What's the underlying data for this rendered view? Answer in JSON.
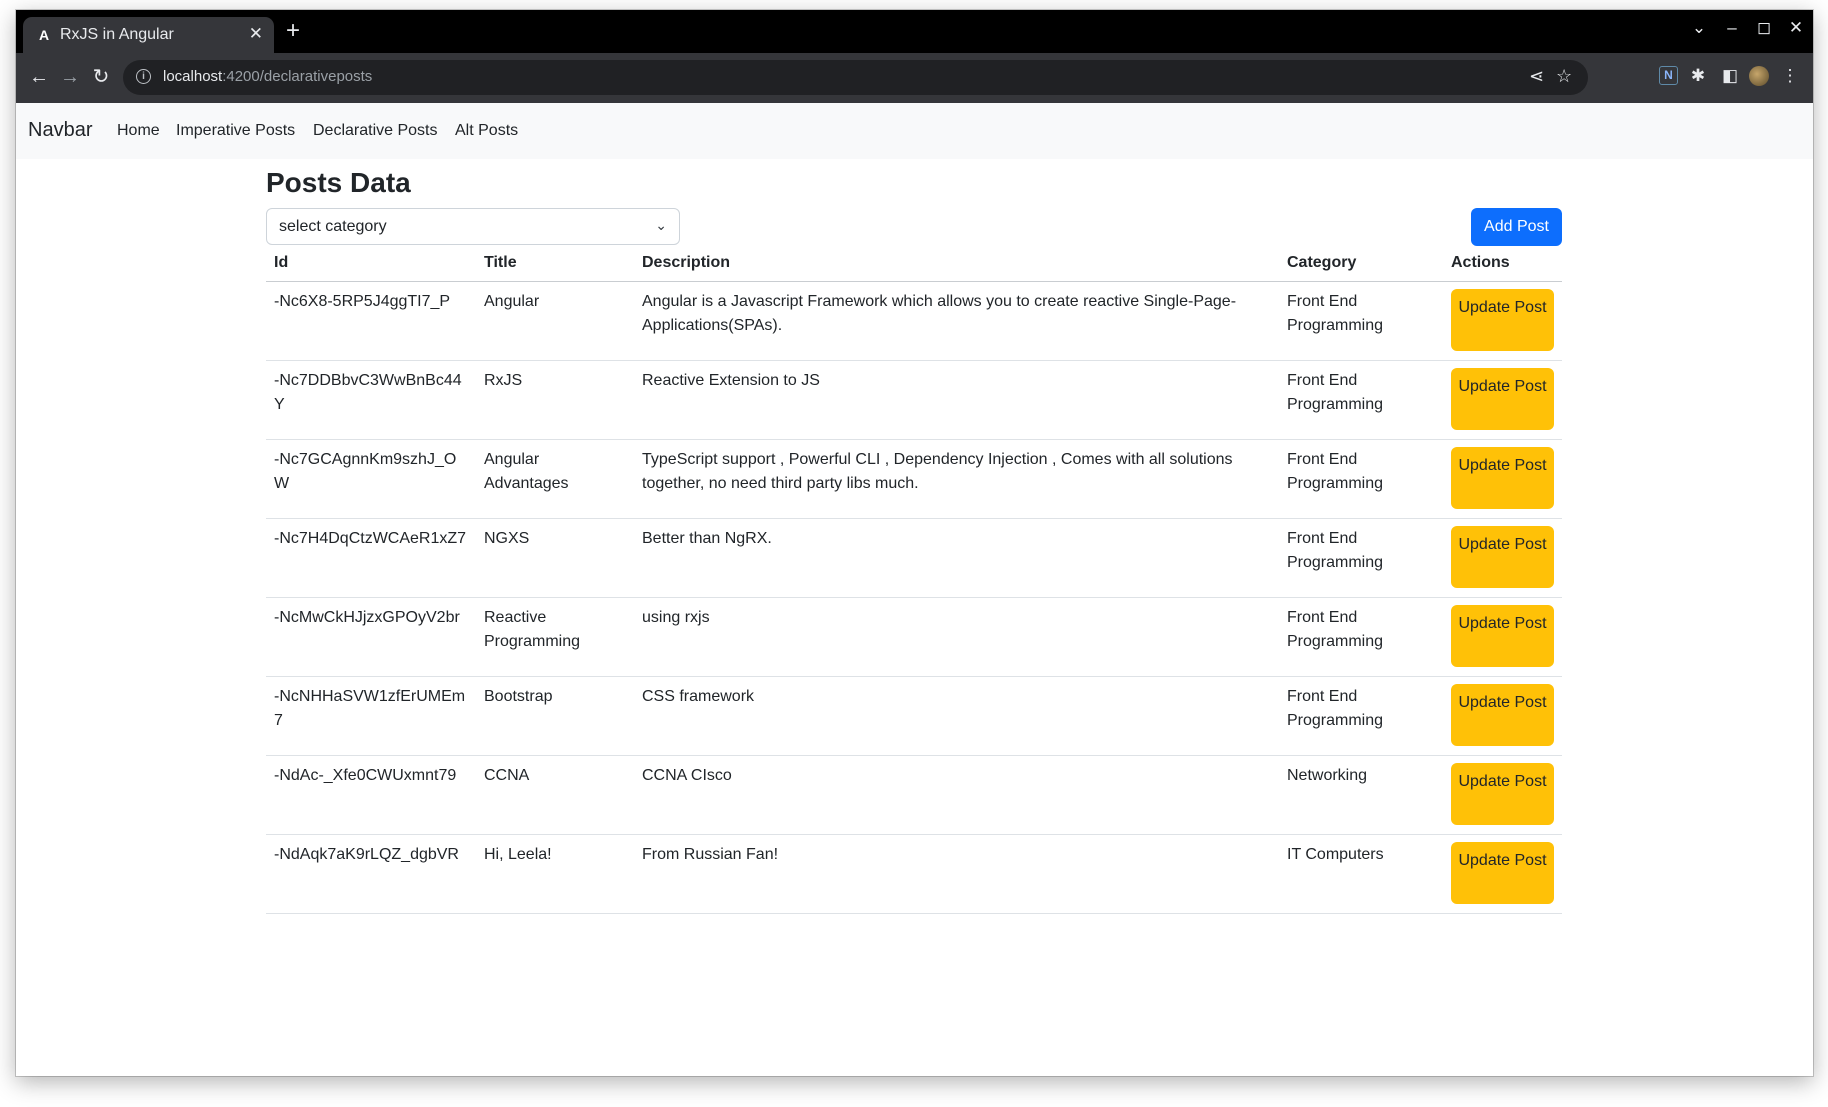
{
  "browser": {
    "tab_title": "RxJS in Angular",
    "tab_favicon": "A",
    "url_host": "localhost",
    "url_path": ":4200/declarativeposts"
  },
  "navbar": {
    "brand": "Navbar",
    "links": [
      "Home",
      "Imperative Posts",
      "Declarative Posts",
      "Alt Posts"
    ]
  },
  "main": {
    "heading": "Posts Data",
    "category_select": {
      "value": "select category"
    },
    "add_button": "Add Post",
    "table": {
      "columns": [
        "Id",
        "Title",
        "Description",
        "Category",
        "Actions"
      ],
      "rows": [
        {
          "id": "-Nc6X8-5RP5J4ggTI7_P",
          "title": "Angular",
          "description": "Angular is a Javascript Framework which allows you to create reactive Single-Page-Applications(SPAs).",
          "category": "Front End Programming",
          "action": "Update Post"
        },
        {
          "id": "-Nc7DDBbvC3WwBnBc44Y",
          "title": "RxJS",
          "description": "Reactive Extension to JS",
          "category": "Front End Programming",
          "action": "Update Post"
        },
        {
          "id": "-Nc7GCAgnnKm9szhJ_OW",
          "title": "Angular Advantages",
          "description": "TypeScript support , Powerful CLI , Dependency Injection , Comes with all solutions together, no need third party libs much.",
          "category": "Front End Programming",
          "action": "Update Post"
        },
        {
          "id": "-Nc7H4DqCtzWCAeR1xZ7",
          "title": "NGXS",
          "description": "Better than NgRX.",
          "category": "Front End Programming",
          "action": "Update Post"
        },
        {
          "id": "-NcMwCkHJjzxGPOyV2br",
          "title": "Reactive Programming",
          "description": "using rxjs",
          "category": "Front End Programming",
          "action": "Update Post"
        },
        {
          "id": "-NcNHHaSVW1zfErUMEm7",
          "title": "Bootstrap",
          "description": "CSS framework",
          "category": "Front End Programming",
          "action": "Update Post"
        },
        {
          "id": "-NdAc-_Xfe0CWUxmnt79",
          "title": "CCNA",
          "description": "CCNA CIsco",
          "category": "Networking",
          "action": "Update Post"
        },
        {
          "id": "-NdAqk7aK9rLQZ_dgbVR",
          "title": "Hi, Leela!",
          "description": "From Russian Fan!",
          "category": "IT Computers",
          "action": "Update Post"
        }
      ]
    }
  },
  "colors": {
    "primary": "#0d6efd",
    "warning": "#ffc107",
    "navbar_bg": "#f8f9fa"
  }
}
